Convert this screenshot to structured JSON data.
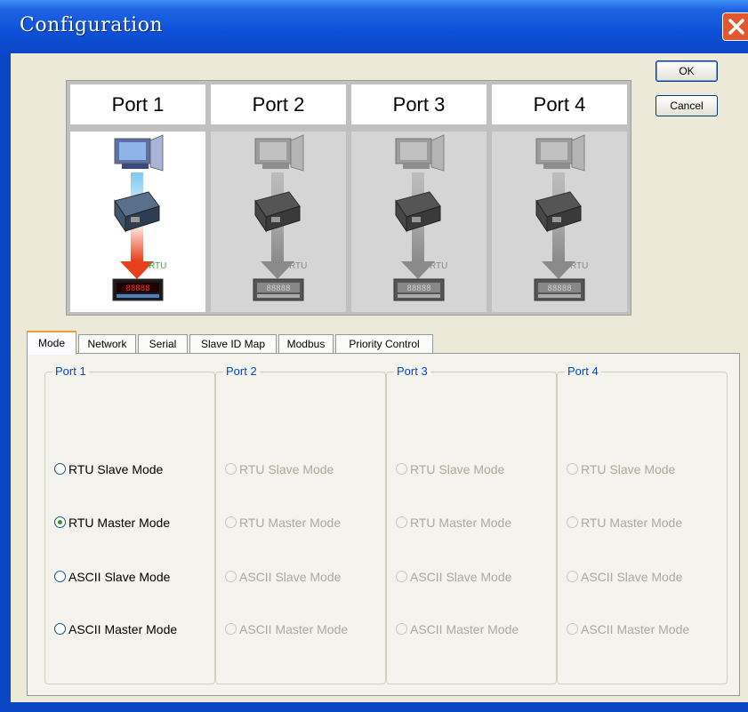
{
  "window": {
    "title": "Configuration"
  },
  "buttons": {
    "ok": "OK",
    "cancel": "Cancel"
  },
  "ports": [
    {
      "label": "Port 1",
      "active": true,
      "protocol": "RTU"
    },
    {
      "label": "Port 2",
      "active": false,
      "protocol": "RTU"
    },
    {
      "label": "Port 3",
      "active": false,
      "protocol": "RTU"
    },
    {
      "label": "Port 4",
      "active": false,
      "protocol": "RTU"
    }
  ],
  "meter_display": "88888",
  "tabs": [
    "Mode",
    "Network",
    "Serial",
    "Slave ID Map",
    "Modbus",
    "Priority Control"
  ],
  "active_tab": "Mode",
  "mode_groups": [
    {
      "label": "Port 1",
      "enabled": true,
      "selected": 1,
      "options": [
        "RTU Slave Mode",
        "RTU Master Mode",
        "ASCII Slave Mode",
        "ASCII Master Mode"
      ]
    },
    {
      "label": "Port 2",
      "enabled": false,
      "selected": null,
      "options": [
        "RTU Slave Mode",
        "RTU Master Mode",
        "ASCII Slave Mode",
        "ASCII Master Mode"
      ]
    },
    {
      "label": "Port 3",
      "enabled": false,
      "selected": null,
      "options": [
        "RTU Slave Mode",
        "RTU Master Mode",
        "ASCII Slave Mode",
        "ASCII Master Mode"
      ]
    },
    {
      "label": "Port 4",
      "enabled": false,
      "selected": null,
      "options": [
        "RTU Slave Mode",
        "RTU Master Mode",
        "ASCII Slave Mode",
        "ASCII Master Mode"
      ]
    }
  ],
  "colors": {
    "titlebar": "#0b46c4",
    "arrow_active_top": "#7cc7f0",
    "arrow_active_bottom": "#e8401c",
    "arrow_inactive": "#8a8a8a",
    "group_label": "#0046d5",
    "radio_selected": "#21a121"
  },
  "icons": {
    "port_device_top": "pc-icon",
    "port_device_middle": "serial-gateway-icon",
    "port_device_bottom": "meter-icon",
    "close": "close-icon"
  }
}
